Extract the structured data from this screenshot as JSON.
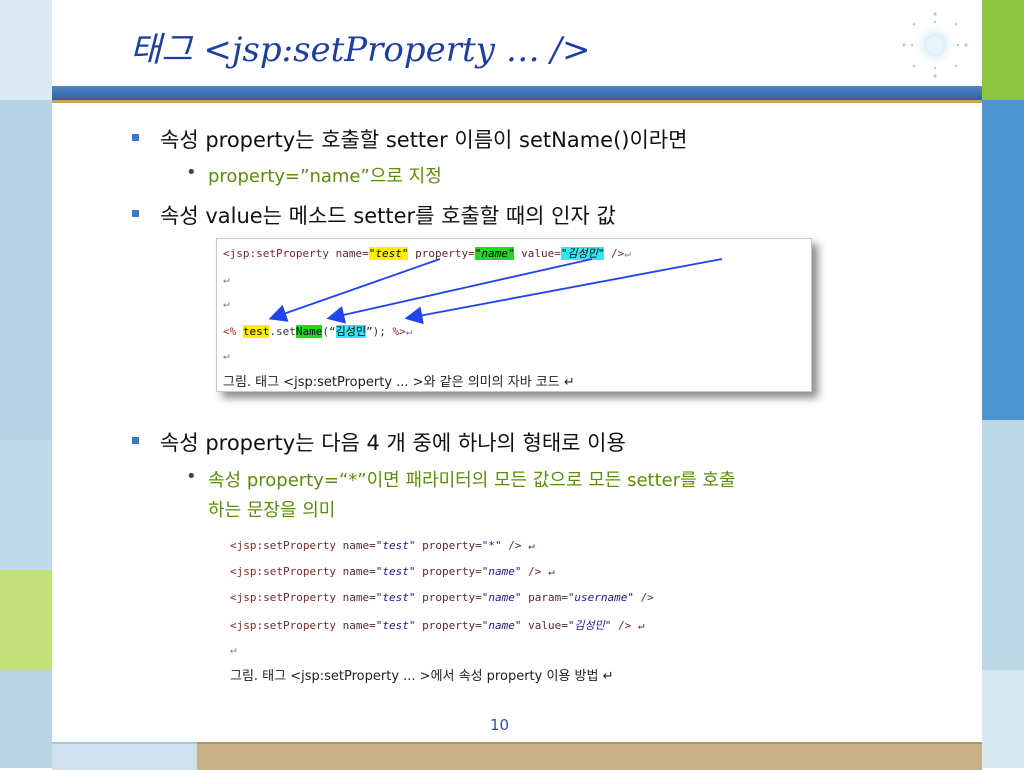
{
  "slide": {
    "title": "태그 <jsp:setProperty … />",
    "page_number": "10"
  },
  "bullets": [
    {
      "level": 1,
      "text": "속성 property는 호출할 setter 이름이  setName()이라면"
    },
    {
      "level": 2,
      "text": "property=”name”으로 지정"
    },
    {
      "level": 1,
      "text": "속성 value는 메소드 setter를 호출할 때의 인자 값"
    },
    {
      "level": 1,
      "text": "속성 property는 다음 4 개 중에 하나의 형태로 이용"
    },
    {
      "level": 2,
      "text": "속성 property=“*”이면 패라미터의 모든 값으로 모든 setter를 호출"
    },
    {
      "level": 2,
      "text": "하는 문장을 의미"
    }
  ],
  "figure1": {
    "tag_open": "<jsp:setProperty",
    "name_attr": " name=",
    "name_val": "\"test\"",
    "prop_attr": " property=",
    "prop_val": "\"name\"",
    "value_attr": " value=",
    "value_val": "\"김성민\"",
    "tag_close": " />",
    "para_mark": "↵",
    "code_open": "<%",
    "code_obj": "test",
    "code_dot": ".set",
    "code_method": "Name",
    "code_arg_open": "(“",
    "code_arg": "김성민",
    "code_arg_close": "”);",
    "code_close": "%>",
    "caption": "그림.  태그 <jsp:setProperty ... >와 같은 의미의 자바 코드 ↵"
  },
  "figure2": {
    "lines": [
      {
        "tag": "<jsp:setProperty",
        "rest_name": " name=",
        "name_val": "\"test\"",
        "rest_prop": " property=",
        "prop_val": "\"*\"",
        "tail": " /> ↵"
      },
      {
        "tag": "<jsp:setProperty",
        "rest_name": " name=",
        "name_val": "\"test\"",
        "rest_prop": " property=",
        "prop_val": "\"name\"",
        "tail": " /> ↵"
      },
      {
        "tag": "<jsp:setProperty",
        "rest_name": " name=",
        "name_val": "\"test\"",
        "rest_prop": " property=",
        "prop_val": "\"name\"",
        "extra_attr": " param=",
        "extra_val": "\"username\"",
        "tail": " />"
      },
      {
        "tag": "<jsp:setProperty",
        "rest_name": " name=",
        "name_val": "\"test\"",
        "rest_prop": " property=",
        "prop_val": "\"name\"",
        "extra_attr": " value=",
        "extra_val": "\"김성민\"",
        "tail": " /> ↵"
      }
    ],
    "para_mark": "↵",
    "caption": "그림.  태그 <jsp:setProperty ... >에서 속성 property 이용 방법 ↵"
  },
  "colors": {
    "title": "#1f3fa0",
    "accent_blue": "#3d78c7",
    "sub_bullet_green": "#5c8c0c",
    "highlight_yellow": "#ffee00",
    "highlight_green": "#22d822",
    "highlight_cyan": "#33e8ee",
    "arrow_blue": "#2244ee"
  }
}
